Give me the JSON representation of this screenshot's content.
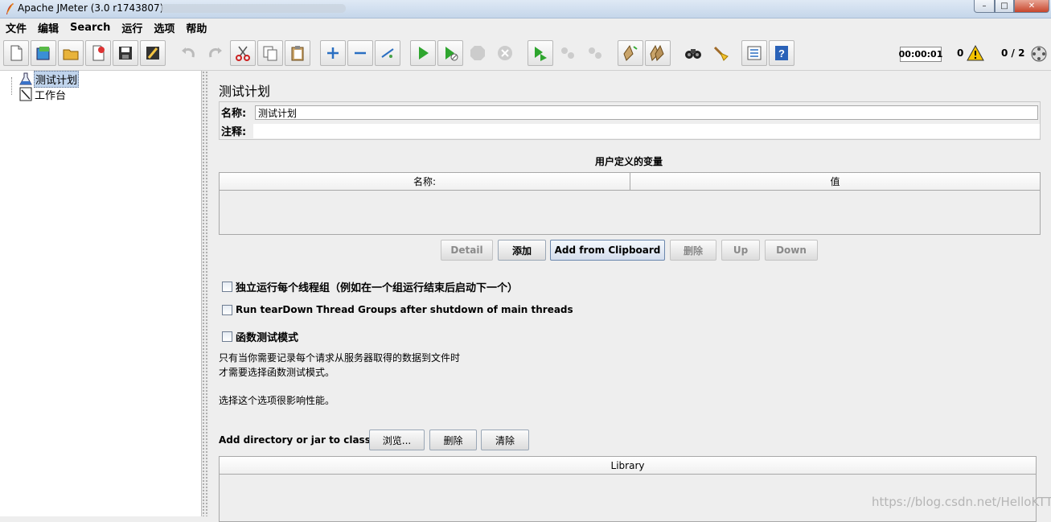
{
  "window": {
    "title": "Apache JMeter (3.0 r1743807)",
    "min_glyph": "–",
    "max_glyph": "□",
    "close_glyph": "✕"
  },
  "menu": [
    "文件",
    "编辑",
    "Search",
    "运行",
    "选项",
    "帮助"
  ],
  "toolbar": {
    "icons": [
      "new-icon",
      "templates-icon",
      "open-icon",
      "close-file-icon",
      "save-icon",
      "save-as-icon",
      "undo-icon",
      "redo-icon",
      "cut-icon",
      "copy-icon",
      "paste-icon",
      "expand-icon",
      "collapse-icon",
      "toggle-icon",
      "start-icon",
      "start-no-pause-icon",
      "stop-icon",
      "shutdown-icon",
      "remote-start-icon",
      "remote-stop-icon",
      "remote-shutdown-icon",
      "clear-icon",
      "clear-all-icon",
      "search-icon",
      "reset-search-icon",
      "function-helper-icon",
      "help-icon"
    ],
    "timer": "00:00:01",
    "error_count": "0",
    "threads": "0 / 2"
  },
  "tree": {
    "nodes": [
      {
        "label": "测试计划",
        "icon": "test-plan-icon",
        "selected": true
      },
      {
        "label": "工作台",
        "icon": "workbench-icon",
        "selected": false
      }
    ]
  },
  "panel": {
    "title": "测试计划",
    "name_label": "名称:",
    "name_value": "测试计划",
    "comment_label": "注释:",
    "comment_value": "",
    "variables_title": "用户定义的变量",
    "columns": [
      "名称:",
      "值"
    ],
    "buttons": {
      "detail": "Detail",
      "add": "添加",
      "add_clipboard": "Add from Clipboard",
      "delete": "删除",
      "up": "Up",
      "down": "Down"
    },
    "checkboxes": {
      "serialize": "独立运行每个线程组（例如在一个组运行结束后启动下一个）",
      "teardown": "Run tearDown Thread Groups after shutdown of main threads",
      "functional": "函数测试模式"
    },
    "notes": {
      "line1": "只有当你需要记录每个请求从服务器取得的数据到文件时",
      "line2": "才需要选择函数测试模式。",
      "line3": "选择这个选项很影响性能。"
    },
    "classpath": {
      "label": "Add directory or jar to classpath",
      "browse": "浏览...",
      "delete": "删除",
      "clear": "清除",
      "column": "Library"
    }
  },
  "watermark": "https://blog.csdn.net/HelloKTT"
}
